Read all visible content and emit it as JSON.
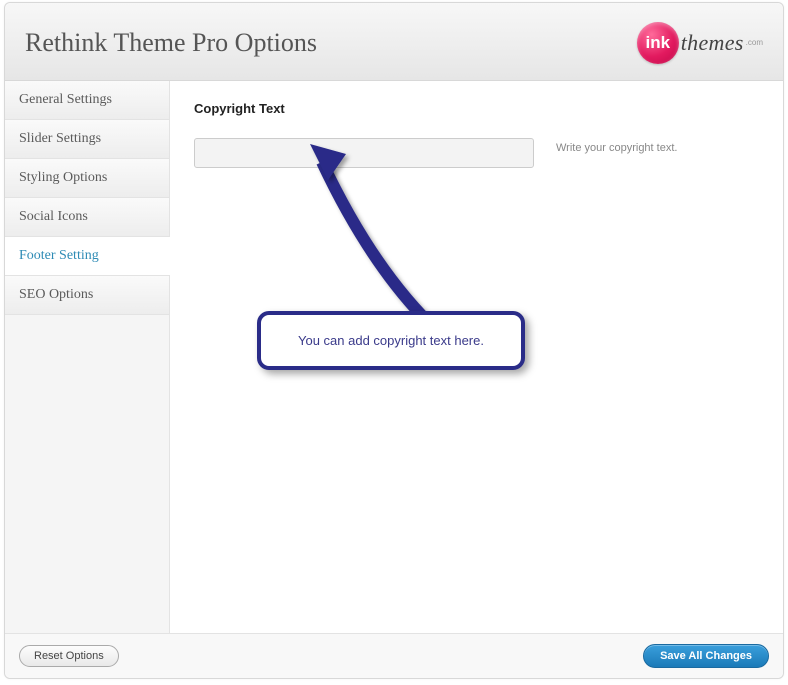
{
  "header": {
    "title": "Rethink Theme Pro Options",
    "logo_circle": "ink",
    "logo_text": "themes",
    "logo_sub": ".com"
  },
  "sidebar": {
    "items": [
      {
        "label": "General Settings",
        "active": false
      },
      {
        "label": "Slider Settings",
        "active": false
      },
      {
        "label": "Styling Options",
        "active": false
      },
      {
        "label": "Social Icons",
        "active": false
      },
      {
        "label": "Footer Setting",
        "active": true
      },
      {
        "label": "SEO Options",
        "active": false
      }
    ]
  },
  "main": {
    "section_title": "Copyright Text",
    "input_value": "",
    "helper_text": "Write your copyright text."
  },
  "callout": {
    "text": "You can add copyright text here."
  },
  "footer": {
    "reset_label": "Reset Options",
    "save_label": "Save All Changes"
  },
  "colors": {
    "accent": "#2a2c88",
    "link": "#2e8bb5",
    "save_btn": "#1b7ab8",
    "logo_pink": "#e21a5f"
  }
}
